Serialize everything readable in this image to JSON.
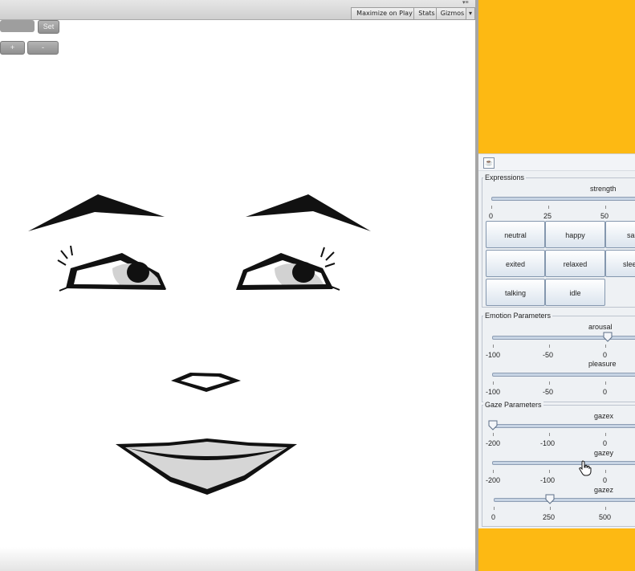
{
  "game_view": {
    "toolbar": {
      "maximize_label": "Maximize on Play",
      "stats_label": "Stats",
      "gizmos_label": "Gizmos",
      "menu_glyph": "▾",
      "corner_glyph": "▾≡"
    },
    "gui": {
      "set_label": "Set",
      "plus_label": "+",
      "minus_label": "-"
    }
  },
  "controller": {
    "window_icon_glyph": "☕",
    "expressions": {
      "group_title": "Expressions",
      "strength_label": "strength",
      "strength_ticks": [
        "0",
        "25",
        "50"
      ],
      "buttons": [
        "neutral",
        "happy",
        "sa",
        "exited",
        "relaxed",
        "slee",
        "talking",
        "idle"
      ]
    },
    "emotion": {
      "group_title": "Emotion Parameters",
      "arousal_label": "arousal",
      "arousal_ticks": [
        "-100",
        "-50",
        "0"
      ],
      "arousal_value": 0,
      "pleasure_label": "pleasure",
      "pleasure_ticks": [
        "-100",
        "-50",
        "0"
      ]
    },
    "gaze": {
      "group_title": "Gaze Parameters",
      "gazex_label": "gazex",
      "gazex_ticks": [
        "-200",
        "-100",
        "0"
      ],
      "gazex_value": -200,
      "gazey_label": "gazey",
      "gazey_ticks": [
        "-200",
        "-100",
        "0"
      ],
      "gazez_label": "gazez",
      "gazez_ticks": [
        "0",
        "250",
        "500"
      ],
      "gazez_value": 250
    }
  },
  "colors": {
    "background_accent": "#fdb913",
    "panel_bg": "#eef1f4",
    "button_border": "#8497ae"
  }
}
